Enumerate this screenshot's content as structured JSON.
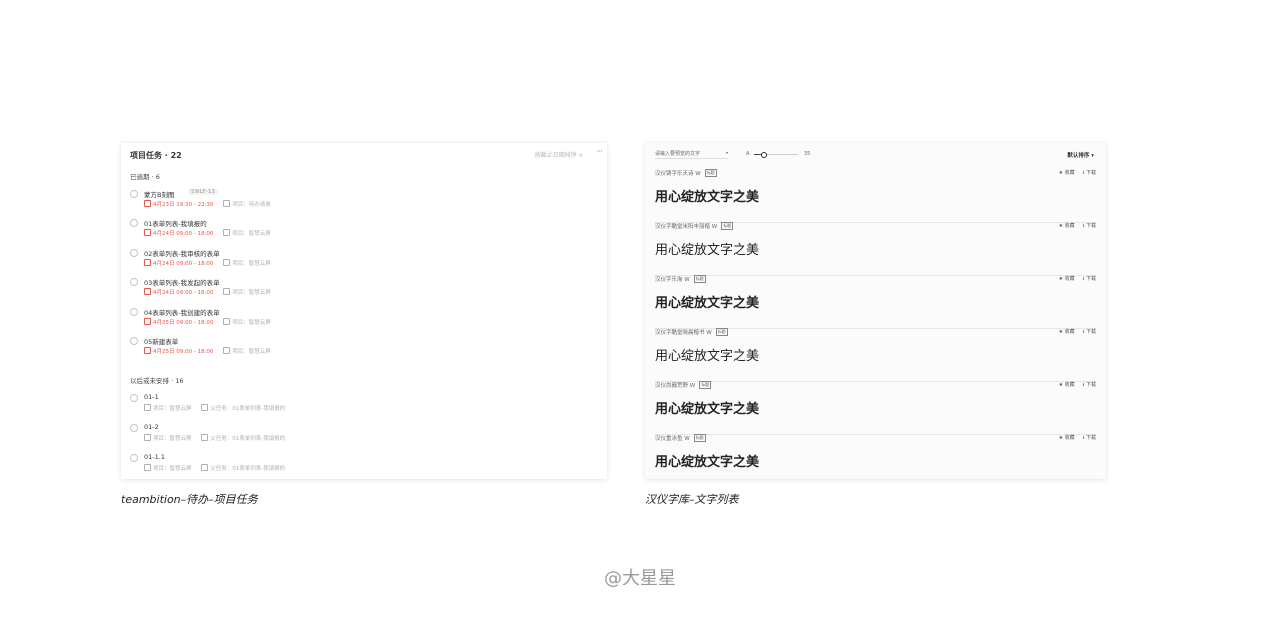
{
  "left_panel": {
    "title": "项目任务 · 22",
    "sort_label": "按截止日期排序 ∨",
    "more": "···",
    "group_overdue": "已逾期 · 6",
    "group_later": "以后或未安排 · 16",
    "overdue_tasks": [
      {
        "name": "蒙方B刻图",
        "tag": "59ILF-13",
        "date": "4月23日 19:30 - 22:30",
        "project": "项目：待办清单"
      },
      {
        "name": "01表单列表-我填报的",
        "date": "4月24日 09:00 - 18:00",
        "project": "项目：智慧云屏"
      },
      {
        "name": "02表单列表-我审核的表单",
        "date": "4月24日 09:00 - 18:00",
        "project": "项目：智慧云屏"
      },
      {
        "name": "03表单列表-我发起的表单",
        "date": "4月24日 09:00 - 18:00",
        "project": "项目：智慧云屏"
      },
      {
        "name": "04表单列表-我创建的表单",
        "date": "4月25日 09:00 - 18:00",
        "project": "项目：智慧云屏"
      },
      {
        "name": "05新建表单",
        "date": "4月25日 09:00 - 18:00",
        "project": "项目：智慧云屏"
      }
    ],
    "later_tasks": [
      {
        "name": "01-1",
        "project": "项目：智慧云屏",
        "parent": "父任务：01表单列表-我填报的"
      },
      {
        "name": "01-2",
        "project": "项目：智慧云屏",
        "parent": "父任务：01表单列表-我填报的"
      },
      {
        "name": "01-1.1",
        "project": "项目：智慧云屏",
        "parent": "父任务：01表单列表-我填报的"
      }
    ]
  },
  "right_panel": {
    "search_placeholder": "请输入要预览的文字",
    "dropdown_arrow": "▾",
    "slider_label": "A",
    "size_value": "35",
    "order_label": "默认排序 ▾",
    "collect_label": "★ 收藏",
    "download_label": "⭳ 下载",
    "badge": "标题",
    "fonts": [
      {
        "name": "汉仪铸字乐天诗 W",
        "sample": "用心绽放文字之美",
        "style": "bold"
      },
      {
        "name": "汉仪字酷堂米阳丰丽楷 W",
        "sample": "用心绽放文字之美",
        "style": "serif"
      },
      {
        "name": "汉仪字乐淘 W",
        "sample": "用心绽放文字之美",
        "style": "bold"
      },
      {
        "name": "汉仪字酷堂晓晨楷书 W",
        "sample": "用心绽放文字之美",
        "style": "serif"
      },
      {
        "name": "汉仪尚巍荒野 W",
        "sample": "用心绽放文字之美",
        "style": "serif-bold"
      },
      {
        "name": "汉仪重冰鱼 W",
        "sample": "用心绽放文字之美",
        "style": "bold"
      }
    ]
  },
  "captions": {
    "left": "teambition–待办–项目任务",
    "right": "汉仪字库–文字列表"
  },
  "watermark": "@大星星",
  "colors": {
    "overdue_date": "#e8574b",
    "muted": "#b0b0b0",
    "watermark": "#999999"
  }
}
